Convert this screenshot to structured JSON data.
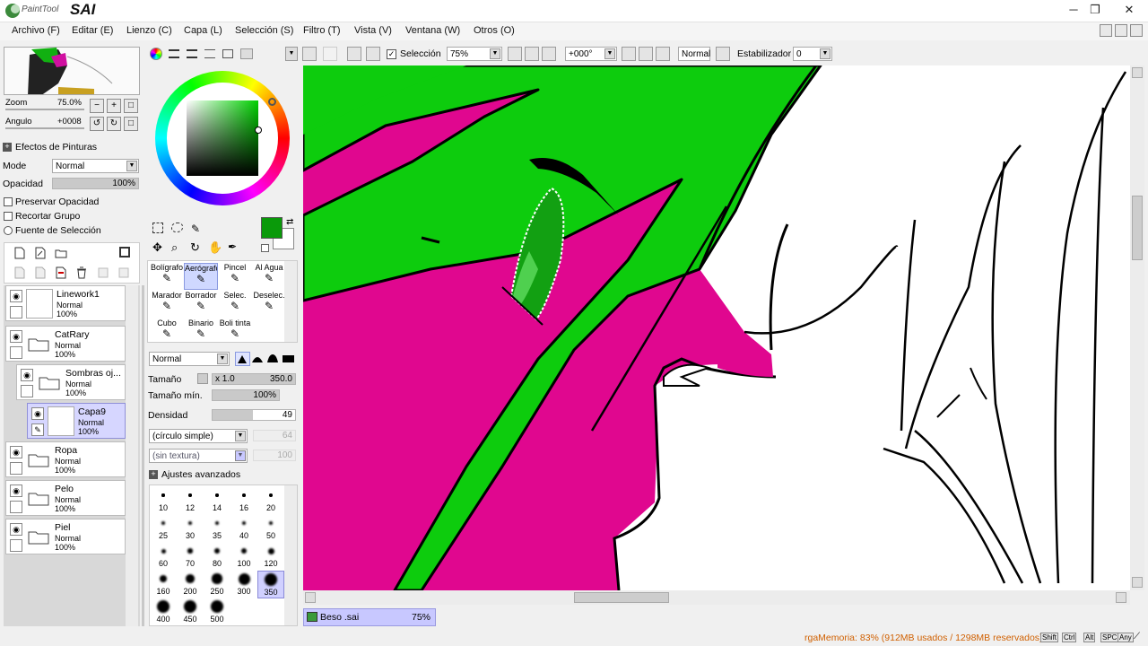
{
  "app": {
    "title": "SAI",
    "logo_prefix": "PaintTool"
  },
  "window_controls": {
    "minimize": "─",
    "maximize": "❐",
    "close": "✕"
  },
  "menu": [
    "Archivo (F)",
    "Editar (E)",
    "Lienzo (C)",
    "Capa (L)",
    "Selección (S)",
    "Filtro (T)",
    "Vista (V)",
    "Ventana (W)",
    "Otros (O)"
  ],
  "navigator": {
    "zoom_label": "Zoom",
    "zoom_value": "75.0%",
    "angle_label": "Angulo",
    "angle_value": "+0008"
  },
  "paint_effects": {
    "header": "Efectos de Pinturas",
    "mode_label": "Mode",
    "mode_value": "Normal",
    "opacity_label": "Opacidad",
    "opacity_value": "100%"
  },
  "layer_options": {
    "preserve_opacity": "Preservar Opacidad",
    "clip_group": "Recortar Grupo",
    "selection_source": "Fuente de Selección"
  },
  "layers": [
    {
      "name": "Linework1",
      "mode": "Normal",
      "opacity": "100%",
      "type": "layer",
      "indent": 0,
      "selected": false
    },
    {
      "name": "CatRary",
      "mode": "Normal",
      "opacity": "100%",
      "type": "folder",
      "indent": 0,
      "selected": false
    },
    {
      "name": "Sombras oj...",
      "mode": "Normal",
      "opacity": "100%",
      "type": "folder",
      "indent": 1,
      "selected": false
    },
    {
      "name": "Capa9",
      "mode": "Normal",
      "opacity": "100%",
      "type": "layer",
      "indent": 2,
      "selected": true
    },
    {
      "name": "Ropa",
      "mode": "Normal",
      "opacity": "100%",
      "type": "folder",
      "indent": 0,
      "selected": false
    },
    {
      "name": "Pelo",
      "mode": "Normal",
      "opacity": "100%",
      "type": "folder",
      "indent": 0,
      "selected": false
    },
    {
      "name": "Piel",
      "mode": "Normal",
      "opacity": "100%",
      "type": "folder",
      "indent": 0,
      "selected": false
    }
  ],
  "colors": {
    "primary": "#0a9a0a",
    "secondary": "#ffffff",
    "accent": "#d0d8ff"
  },
  "tools": [
    {
      "label": "Bolígrafo",
      "selected": false
    },
    {
      "label": "Aerógrafo",
      "selected": true
    },
    {
      "label": "Pincel",
      "selected": false
    },
    {
      "label": "Al Agua",
      "selected": false
    },
    {
      "label": "Marador",
      "selected": false
    },
    {
      "label": "Borrador",
      "selected": false
    },
    {
      "label": "Selec.",
      "selected": false
    },
    {
      "label": "Deselec.",
      "selected": false
    },
    {
      "label": "Cubo",
      "selected": false
    },
    {
      "label": "Binario",
      "selected": false
    },
    {
      "label": "Boli tinta",
      "selected": false
    }
  ],
  "brush": {
    "mode": "Normal",
    "size_label": "Tamaño",
    "size_mult": "x 1.0",
    "size_value": "350.0",
    "min_size_label": "Tamaño mín.",
    "min_size_value": "100%",
    "density_label": "Densidad",
    "density_value": "49",
    "shape": "(círculo simple)",
    "shape_value": "64",
    "texture": "(sin textura)",
    "texture_value": "100",
    "advanced": "Ajustes avanzados",
    "sizes": [
      "10",
      "12",
      "14",
      "16",
      "20",
      "25",
      "30",
      "35",
      "40",
      "50",
      "60",
      "70",
      "80",
      "100",
      "120",
      "160",
      "200",
      "250",
      "300",
      "350",
      "400",
      "450",
      "500"
    ],
    "selected_size": "350"
  },
  "canvas_toolbar": {
    "selection_label": "Selección",
    "zoom": "75%",
    "angle": "+000°",
    "blend": "Normal",
    "stabilizer_label": "Estabilizador",
    "stabilizer_value": "0"
  },
  "document_tab": {
    "name": "Beso .sai",
    "zoom": "75%"
  },
  "status": {
    "memory": "rgaMemoria: 83% (912MB usados / 1298MB reservados)",
    "keys": [
      "Shift",
      "Ctrl",
      "Alt",
      "SPC",
      "Any"
    ]
  }
}
